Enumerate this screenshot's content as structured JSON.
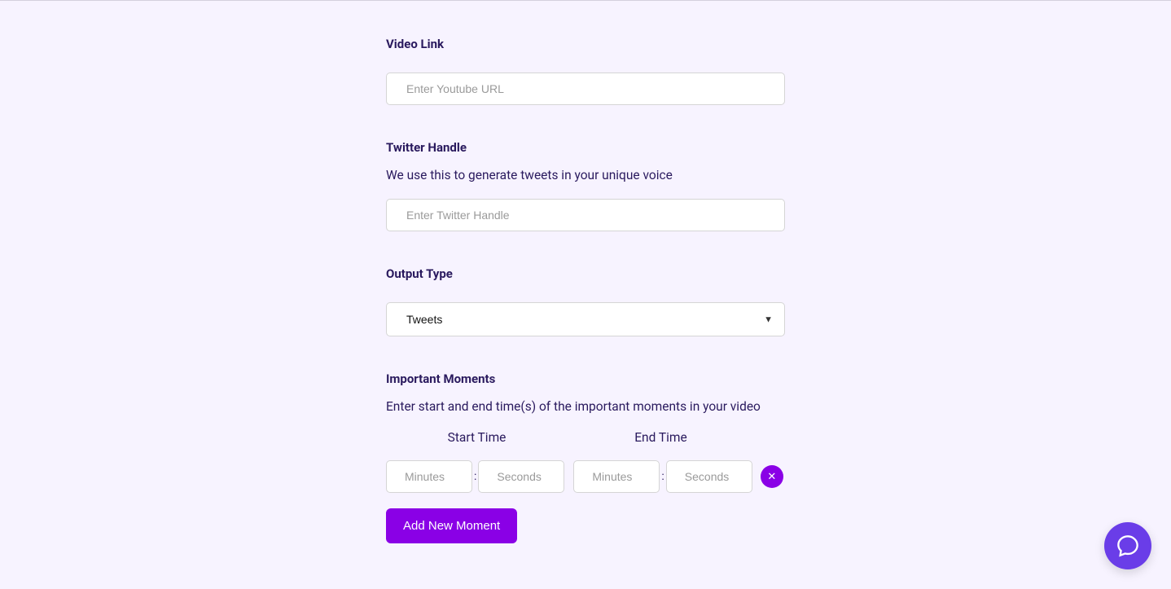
{
  "videoLink": {
    "label": "Video Link",
    "placeholder": "Enter Youtube URL",
    "value": ""
  },
  "twitterHandle": {
    "label": "Twitter Handle",
    "description": "We use this to generate tweets in your unique voice",
    "placeholder": "Enter Twitter Handle",
    "value": ""
  },
  "outputType": {
    "label": "Output Type",
    "selected": "Tweets"
  },
  "importantMoments": {
    "label": "Important Moments",
    "description": "Enter start and end time(s) of the important moments in your video",
    "startTimeLabel": "Start Time",
    "endTimeLabel": "End Time",
    "colon": ":",
    "minutesPlaceholder": "Minutes",
    "secondsPlaceholder": "Seconds",
    "removeLabel": "✕",
    "addButtonLabel": "Add New Moment"
  },
  "chatIconName": "chat-icon"
}
